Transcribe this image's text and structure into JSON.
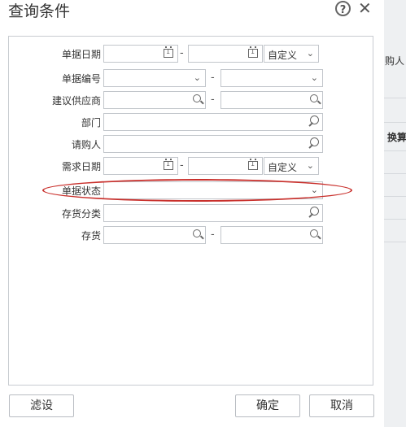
{
  "dialog": {
    "title": "查询条件"
  },
  "fields": {
    "doc_date": {
      "label": "单据日期",
      "range_type": "自定义"
    },
    "doc_no": {
      "label": "单据编号"
    },
    "supplier": {
      "label": "建议供应商"
    },
    "department": {
      "label": "部门"
    },
    "requester": {
      "label": "请购人"
    },
    "demand_date": {
      "label": "需求日期",
      "range_type": "自定义"
    },
    "doc_status": {
      "label": "单据状态"
    },
    "inventory_class": {
      "label": "存货分类"
    },
    "inventory": {
      "label": "存货"
    }
  },
  "range_separator": "-",
  "buttons": {
    "filter": "滤设",
    "ok": "确定",
    "cancel": "取消"
  },
  "background": {
    "requester_col": "购人",
    "exchange_col": "换算"
  },
  "colors": {
    "highlight": "#c9302c",
    "border": "#c2c6cb"
  }
}
